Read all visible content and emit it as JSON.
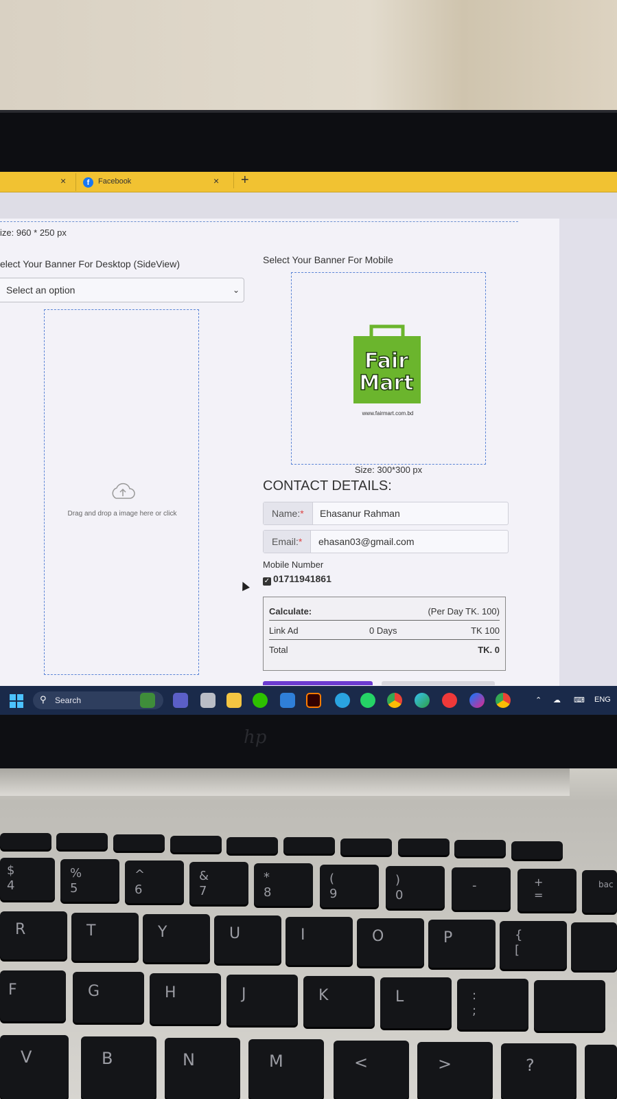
{
  "browser": {
    "tabs": [
      {
        "title": "",
        "close": "×"
      },
      {
        "title": "Facebook",
        "close": "×"
      }
    ],
    "new_tab": "+"
  },
  "form": {
    "desktop_size": "ize: 960 * 250 px",
    "desktop_label": "elect Your Banner For Desktop (SideView)",
    "select": {
      "value": "Select an option"
    },
    "dropzone_text": "Drag and drop a image here or click",
    "mobile_label": "Select Your Banner For Mobile",
    "mobile_logo": {
      "line1": "Fair",
      "line2": "Mart",
      "url": "www.fairmart.com.bd"
    },
    "mobile_size": "Size: 300*300 px"
  },
  "contact": {
    "title": "CONTACT DETAILS:",
    "name_label": "Name:",
    "name_value": "Ehasanur Rahman",
    "email_label": "Email:",
    "email_value": "ehasan03@gmail.com",
    "required_mark": "*",
    "mobile_label": "Mobile Number",
    "mobile_value": "01711941861"
  },
  "calculate": {
    "title": "Calculate:",
    "per_day": "(Per Day TK. 100)",
    "link_ad_label": "Link Ad",
    "days": "0 Days",
    "amount": "TK 100",
    "total_label": "Total",
    "total_value": "TK. 0"
  },
  "taskbar": {
    "search": "Search",
    "language": "ENG",
    "apps": [
      "widgets-icon",
      "teams-icon",
      "taskview-icon",
      "file-explorer-icon",
      "wechat-icon",
      "calculator-icon",
      "illustrator-icon",
      "telegram-icon",
      "whatsapp-icon",
      "chrome-icon",
      "edge-icon",
      "vivaldi-icon",
      "messenger-icon",
      "chrome-profile-icon"
    ]
  },
  "keyboard": {
    "row1": [
      "$\n4",
      "%\n5",
      "^\n6",
      "&\n7",
      "*\n8",
      "(\n9",
      ")\n0",
      "-",
      "+\n=",
      "bac"
    ],
    "row2": [
      "R",
      "T",
      "Y",
      "U",
      "I",
      "O",
      "P",
      "{\n["
    ],
    "row3": [
      "F",
      "G",
      "H",
      "J",
      "K",
      "L",
      ":\n;"
    ],
    "row4": [
      "V",
      "B",
      "N",
      "M",
      "<",
      ">",
      "?"
    ]
  },
  "colors": {
    "tab_strip": "#f1c232",
    "taskbar": "#1a2a4a",
    "dashed_border": "#5a84d6",
    "logo_green": "#6bb52d"
  }
}
